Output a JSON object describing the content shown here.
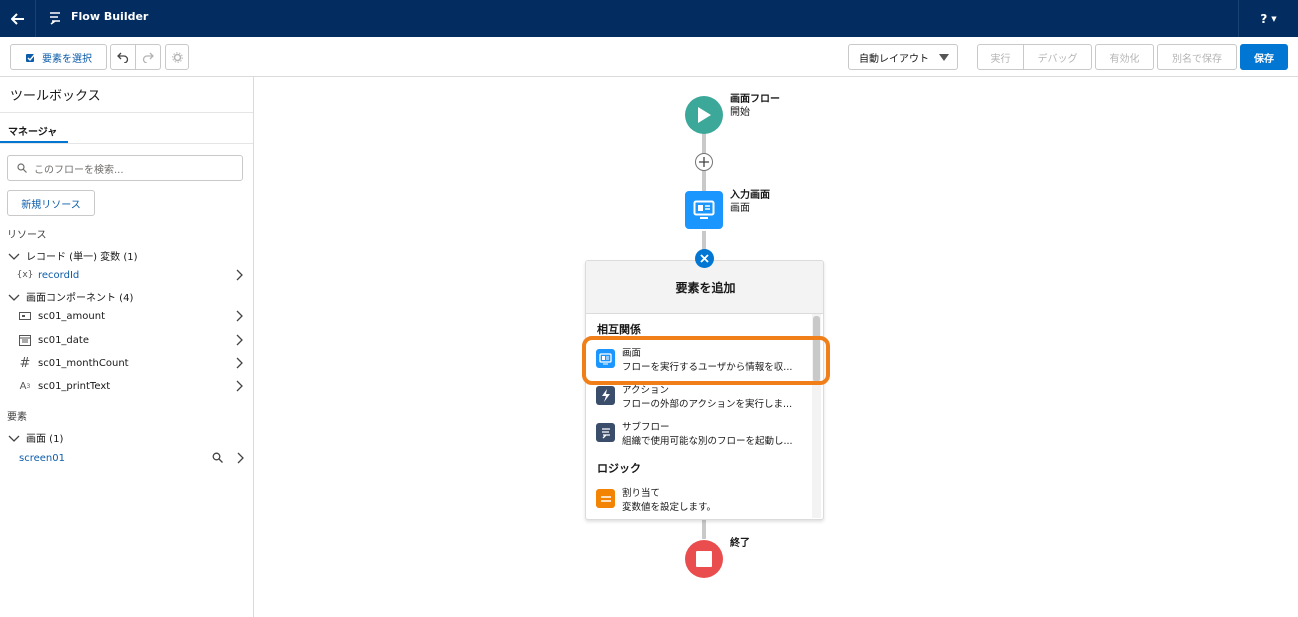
{
  "header": {
    "title": "Flow Builder",
    "help_label": "?"
  },
  "toolbar": {
    "select_element": "要素を選択",
    "layout_select": "自動レイアウト",
    "run": "実行",
    "debug": "デバッグ",
    "activate": "有効化",
    "save_as": "別名で保存",
    "save": "保存"
  },
  "sidebar": {
    "title": "ツールボックス",
    "tab": "マネージャ",
    "search_placeholder": "このフローを検索...",
    "new_resource": "新規リソース",
    "resources_label": "リソース",
    "record_group": "レコード (単一) 変数 (1)",
    "record_items": [
      {
        "label": "recordId",
        "icon": "{x}"
      }
    ],
    "screen_comp_group": "画面コンポーネント (4)",
    "screen_comp_items": [
      {
        "label": "sc01_amount",
        "icon": "input-icon"
      },
      {
        "label": "sc01_date",
        "icon": "calendar-icon"
      },
      {
        "label": "sc01_monthCount",
        "icon": "#"
      },
      {
        "label": "sc01_printText",
        "icon": "text-icon"
      }
    ],
    "elements_label": "要素",
    "screen_group": "画面 (1)",
    "screen_items": [
      {
        "label": "screen01"
      }
    ]
  },
  "canvas": {
    "start_title": "画面フロー",
    "start_sub": "開始",
    "screen_title": "入力画面",
    "screen_sub": "画面",
    "end_title": "終了"
  },
  "panel": {
    "title": "要素を追加",
    "section_interaction": "相互関係",
    "items_interaction": [
      {
        "title": "画面",
        "desc": "フローを実行するユーザから情報を収...",
        "icon": "screen-icon",
        "color": "#1b96ff"
      },
      {
        "title": "アクション",
        "desc": "フローの外部のアクションを実行しま...",
        "icon": "bolt-icon",
        "color": "#3a4d6b"
      },
      {
        "title": "サブフロー",
        "desc": "組織で使用可能な別のフローを起動し...",
        "icon": "flow-icon",
        "color": "#3a4d6b"
      }
    ],
    "section_logic": "ロジック",
    "items_logic": [
      {
        "title": "割り当て",
        "desc": "変数値を設定します。",
        "icon": "assignment-icon",
        "color": "#f38303"
      }
    ]
  },
  "colors": {
    "header": "#032d60",
    "brand": "#0176d3",
    "start": "#3ba89a",
    "end": "#ea4d4d",
    "highlight": "#f07f1a"
  }
}
